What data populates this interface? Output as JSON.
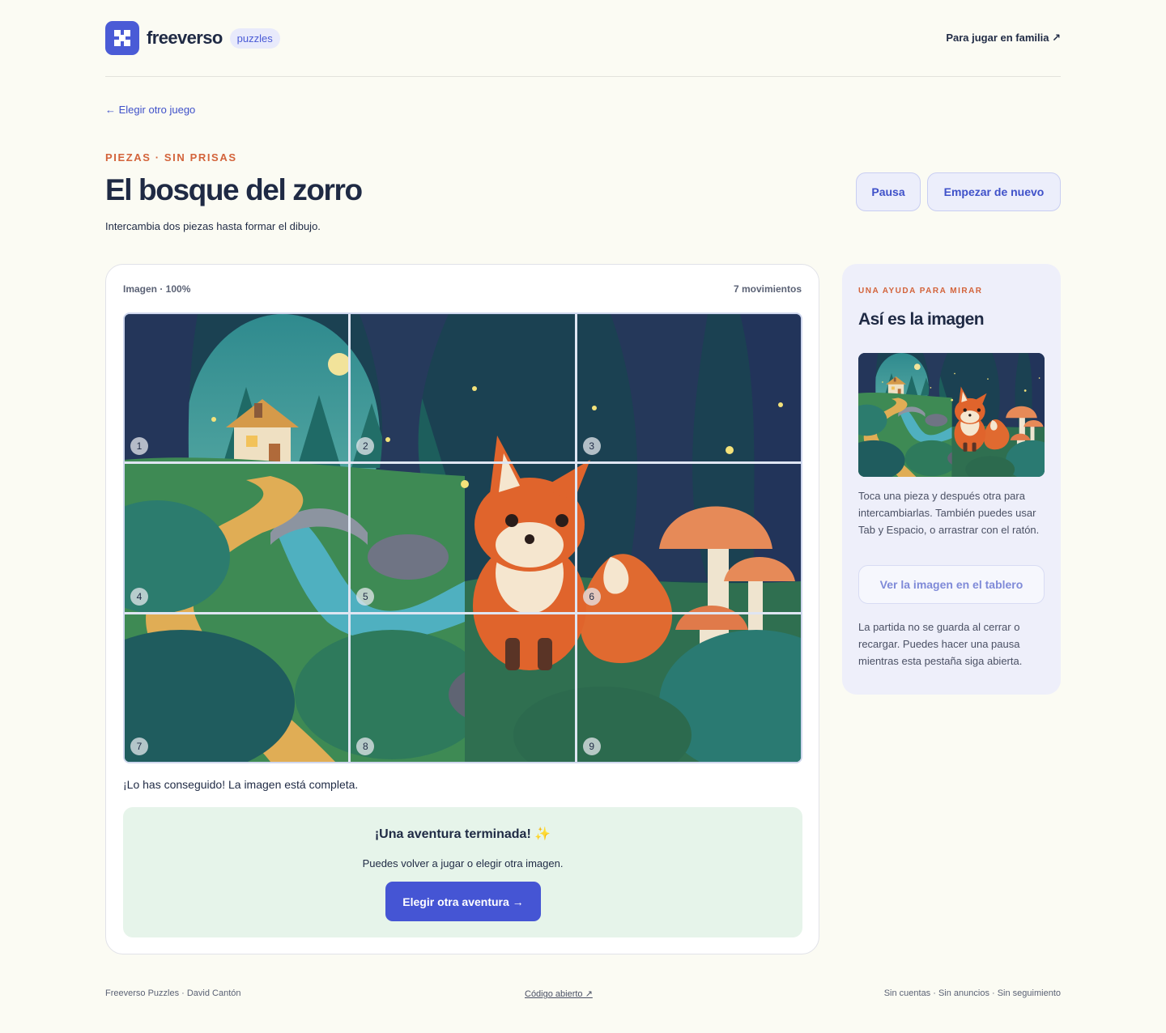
{
  "header": {
    "brand": "freeverso",
    "badge": "puzzles",
    "family_link": "Para jugar en familia ↗"
  },
  "nav": {
    "back": "← Elegir otro juego"
  },
  "game": {
    "kicker": "PIEZAS · SIN PRISAS",
    "title": "El bosque del zorro",
    "subtitle": "Intercambia dos piezas hasta formar el dibujo.",
    "pause_label": "Pausa",
    "restart_label": "Empezar de nuevo"
  },
  "board": {
    "image_label": "Imagen · 100%",
    "moves_label": "7 movimientos",
    "tiles": [
      "1",
      "2",
      "3",
      "4",
      "5",
      "6",
      "7",
      "8",
      "9"
    ],
    "status": "¡Lo has conseguido! La imagen está completa."
  },
  "complete": {
    "title": "¡Una aventura terminada! ✨",
    "text": "Puedes volver a jugar o elegir otra imagen.",
    "button": "Elegir otra aventura →"
  },
  "side": {
    "kicker": "UNA AYUDA PARA MIRAR",
    "title": "Así es la imagen",
    "help": "Toca una pieza y después otra para intercambiarlas. También puedes usar Tab y Espacio, o arrastrar con el ratón.",
    "view_button": "Ver la imagen en el tablero",
    "note": "La partida no se guarda al cerrar o recargar. Puedes hacer una pausa mientras esta pestaña siga abierta."
  },
  "footer": {
    "left": "Freeverso Puzzles · David Cantón",
    "center": "Código abierto ↗",
    "right": "Sin cuentas · Sin anuncios · Sin seguimiento"
  },
  "colors": {
    "accent": "#4555d4",
    "kicker": "#d3633a",
    "success_bg": "#e6f4ea",
    "page_bg": "#fbfbf3"
  }
}
